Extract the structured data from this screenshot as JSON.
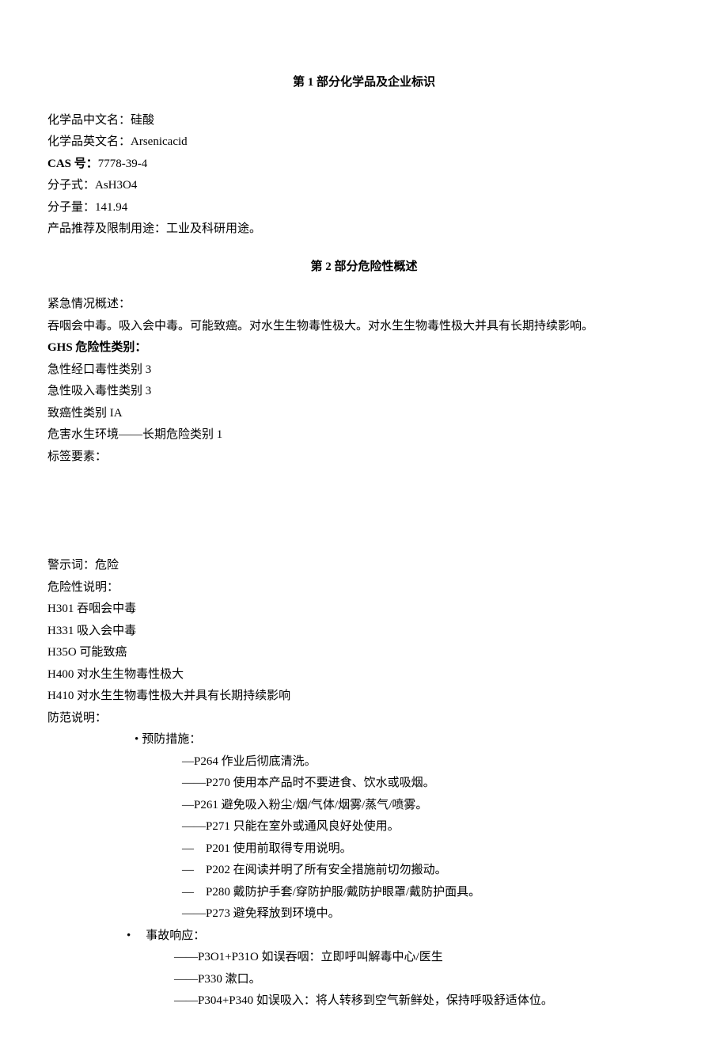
{
  "section1": {
    "title": "第 1 部分化学品及企业标识",
    "name_cn_label": "化学品中文名：",
    "name_cn_value": "硅酸",
    "name_en_label": "化学品英文名：",
    "name_en_value": "Arsenicacid",
    "cas_label": "CAS 号：",
    "cas_value": "7778-39-4",
    "formula_label": "分子式：",
    "formula_value": "AsH3O4",
    "mw_label": "分子量：",
    "mw_value": "141.94",
    "usage_label": "产品推荐及限制用途：",
    "usage_value": "工业及科研用途。"
  },
  "section2": {
    "title": "第 2 部分危险性概述",
    "emergency_label": "紧急情况概述：",
    "emergency_text": "吞咽会中毒。吸入会中毒。可能致癌。对水生生物毒性极大。对水生生物毒性极大并具有长期持续影响。",
    "ghs_label": "GHS 危险性类别：",
    "ghs_lines": [
      "急性经口毒性类别 3",
      "急性吸入毒性类别 3",
      "致癌性类别 IA",
      "危害水生环境——长期危险类别 1"
    ],
    "label_elements": "标签要素：",
    "signal_word_line": "警示词：危险",
    "hazard_statements_label": "危险性说明：",
    "hazard_statements": [
      "H301 吞咽会中毒",
      "H331 吸入会中毒",
      "H35O 可能致癌",
      "H400 对水生生物毒性极大",
      "H410 对水生生物毒性极大并具有长期持续影响"
    ],
    "precaution_label": "防范说明：",
    "prevention_header": "预防措施：",
    "prevention_items": [
      "—P264 作业后彻底清洗。",
      "——P270 使用本产品时不要进食、饮水或吸烟。",
      "—P261 避免吸入粉尘/烟/气体/烟雾/蒸气/喷雾。",
      "——P271 只能在室外或通风良好处使用。",
      "— P201 使用前取得专用说明。",
      "— P202 在阅读并明了所有安全措施前切勿搬动。",
      "— P280 戴防护手套/穿防护服/戴防护眼罩/戴防护面具。",
      "——P273 避免释放到环境中。"
    ],
    "response_header": "事故响应：",
    "response_items": [
      "——P3O1+P31O 如误吞咽：立即呼叫解毒中心/医生",
      "——P330 漱口。",
      "——P304+P340 如误吸入：将人转移到空气新鲜处，保持呼吸舒适体位。"
    ]
  }
}
